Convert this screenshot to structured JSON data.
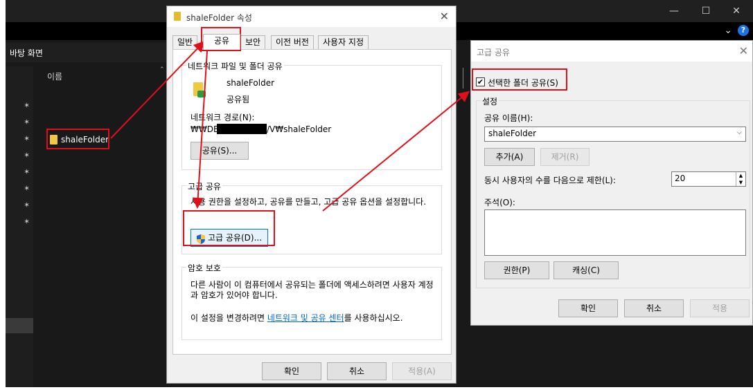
{
  "explorer": {
    "address": "바탕 화면",
    "column_name": "이름",
    "file_name": "shaleFolder",
    "window_buttons": [
      "—",
      "☐",
      "✕"
    ],
    "chevron": "⌄",
    "help": "?"
  },
  "properties": {
    "title": "shaleFolder 속성",
    "tabs": [
      "일반",
      "공유",
      "보안",
      "이전 버전",
      "사용자 지정"
    ],
    "active_tab": "공유",
    "network_group": {
      "caption": "네트워크 파일 및 폴더 공유",
      "folder_name": "shaleFolder",
      "status": "공유됨",
      "path_label": "네트워크 경로(N):",
      "path_prefix": "₩₩DES",
      "path_suffix": "/V₩shaleFolder",
      "share_button": "공유(S)..."
    },
    "advanced_group": {
      "caption": "고급 공유",
      "description": "사용 권한을 설정하고, 공유를 만들고, 고급 공유 옵션을 설정합니다.",
      "advanced_button": "고급 공유(D)..."
    },
    "password_group": {
      "caption": "암호 보호",
      "description": "다른 사람이 이 컴퓨터에서 공유되는 폴더에 액세스하려면 사용자 계정과 암호가 있어야 합니다.",
      "change_prefix": "이 설정을 변경하려면 ",
      "change_link": "네트워크 및 공유 센터",
      "change_suffix": "를 사용하십시오."
    },
    "buttons": {
      "ok": "확인",
      "cancel": "취소",
      "apply": "적용(A)"
    }
  },
  "advanced": {
    "title": "고급 공유",
    "share_checkbox_label": "선택한 폴더 공유(S)",
    "share_checked": true,
    "settings_caption": "설정",
    "share_name_label": "공유 이름(H):",
    "share_name_value": "shaleFolder",
    "add_button": "추가(A)",
    "remove_button": "제거(R)",
    "limit_label": "동시 사용자의 수를 다음으로 제한(L):",
    "limit_value": "20",
    "comment_label": "주석(O):",
    "comment_value": "",
    "permissions_button": "권한(P)",
    "caching_button": "캐싱(C)",
    "ok": "확인",
    "cancel": "취소",
    "apply": "적용"
  },
  "colors": {
    "annotation_red": "#e0101b",
    "link_blue": "#0066cc",
    "folder_yellow": "#f2c744",
    "explorer_bg": "#191919"
  }
}
